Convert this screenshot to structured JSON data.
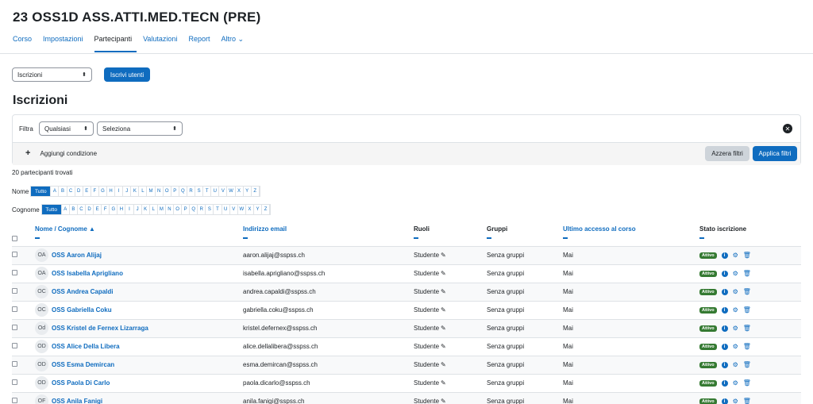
{
  "course": {
    "title": "23 OSS1D ASS.ATTI.MED.TECN (PRE)"
  },
  "tabs": [
    {
      "label": "Corso",
      "active": false
    },
    {
      "label": "Impostazioni",
      "active": false
    },
    {
      "label": "Partecipanti",
      "active": true
    },
    {
      "label": "Valutazioni",
      "active": false
    },
    {
      "label": "Report",
      "active": false
    },
    {
      "label": "Altro ⌄",
      "active": false
    }
  ],
  "toolbar": {
    "view_select": "Iscrizioni",
    "enrol_button": "Iscrivi utenti"
  },
  "heading": "Iscrizioni",
  "filter": {
    "label": "Filtra",
    "match_select": "Qualsiasi",
    "type_select": "Seleziona",
    "add_condition": "Aggiungi condizione",
    "reset_button": "Azzera filtri",
    "apply_button": "Applica filtri"
  },
  "found_text": "20 partecipanti trovati",
  "initials_bar": {
    "first_label": "Nome",
    "last_label": "Cognome",
    "all_label": "Tutto",
    "letters": [
      "A",
      "B",
      "C",
      "D",
      "E",
      "F",
      "G",
      "H",
      "I",
      "J",
      "K",
      "L",
      "M",
      "N",
      "O",
      "P",
      "Q",
      "R",
      "S",
      "T",
      "U",
      "V",
      "W",
      "X",
      "Y",
      "Z"
    ]
  },
  "table": {
    "headers": {
      "name": "Nome / Cognome ▲",
      "email": "Indirizzo email",
      "roles": "Ruoli",
      "groups": "Gruppi",
      "last_access": "Ultimo accesso al corso",
      "status": "Stato iscrizione"
    },
    "rows": [
      {
        "initials": "OA",
        "name": "OSS Aaron Alijaj",
        "email": "aaron.alijaj@sspss.ch",
        "role": "Studente",
        "groups": "Senza gruppi",
        "last_access": "Mai",
        "status": "Attivo"
      },
      {
        "initials": "OA",
        "name": "OSS Isabella Aprigliano",
        "email": "isabella.aprigliano@sspss.ch",
        "role": "Studente",
        "groups": "Senza gruppi",
        "last_access": "Mai",
        "status": "Attivo"
      },
      {
        "initials": "OC",
        "name": "OSS Andrea Capaldi",
        "email": "andrea.capaldi@sspss.ch",
        "role": "Studente",
        "groups": "Senza gruppi",
        "last_access": "Mai",
        "status": "Attivo"
      },
      {
        "initials": "OC",
        "name": "OSS Gabriella Coku",
        "email": "gabriella.coku@sspss.ch",
        "role": "Studente",
        "groups": "Senza gruppi",
        "last_access": "Mai",
        "status": "Attivo"
      },
      {
        "initials": "Od",
        "name": "OSS Kristel de Fernex Lizarraga",
        "email": "kristel.defernex@sspss.ch",
        "role": "Studente",
        "groups": "Senza gruppi",
        "last_access": "Mai",
        "status": "Attivo"
      },
      {
        "initials": "OD",
        "name": "OSS Alice Della Libera",
        "email": "alice.dellalibera@sspss.ch",
        "role": "Studente",
        "groups": "Senza gruppi",
        "last_access": "Mai",
        "status": "Attivo"
      },
      {
        "initials": "OD",
        "name": "OSS Esma Demircan",
        "email": "esma.demircan@sspss.ch",
        "role": "Studente",
        "groups": "Senza gruppi",
        "last_access": "Mai",
        "status": "Attivo"
      },
      {
        "initials": "OD",
        "name": "OSS Paola Di Carlo",
        "email": "paola.dicarlo@sspss.ch",
        "role": "Studente",
        "groups": "Senza gruppi",
        "last_access": "Mai",
        "status": "Attivo"
      },
      {
        "initials": "OF",
        "name": "OSS Anila Fanigi",
        "email": "anila.fanigi@sspss.ch",
        "role": "Studente",
        "groups": "Senza gruppi",
        "last_access": "Mai",
        "status": "Attivo"
      }
    ]
  },
  "colors": {
    "accent": "#0f6cbf",
    "active_badge": "#357a32"
  },
  "icons": {
    "edit": "pencil-icon",
    "info": "info-icon",
    "settings": "gear-icon",
    "delete": "trash-icon",
    "clear_filter": "close-circle-icon"
  }
}
